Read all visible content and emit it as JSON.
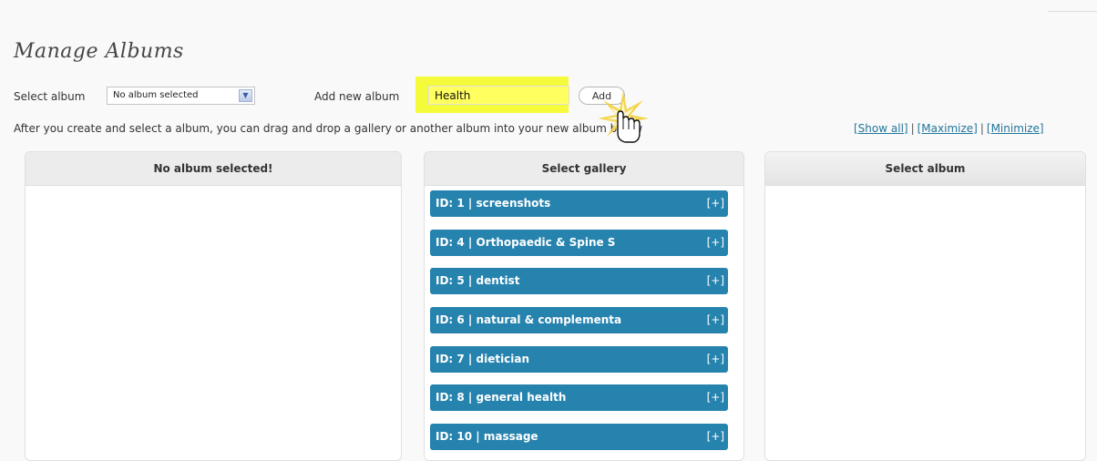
{
  "page": {
    "title": "Manage Albums"
  },
  "controls": {
    "select_album_label": "Select album",
    "select_album_value": "No album selected",
    "add_new_album_label": "Add new album",
    "new_album_value": "Health",
    "add_button_label": "Add",
    "highlight_color": "#f5fb3a"
  },
  "hint": {
    "text": "After you create and select a album, you can drag and drop a gallery or another album into your new album below",
    "links": {
      "show_all": "[Show all]",
      "maximize": "[Maximize]",
      "minimize": "[Minimize]",
      "separator": "|"
    }
  },
  "panels": {
    "left": {
      "title": "No album selected!"
    },
    "middle": {
      "title": "Select gallery",
      "items": [
        {
          "label": "ID: 1 | screenshots",
          "action": "[+]"
        },
        {
          "label": "ID: 4 | Orthopaedic & Spine S",
          "action": "[+]"
        },
        {
          "label": "ID: 5 | dentist",
          "action": "[+]"
        },
        {
          "label": "ID: 6 | natural & complementa",
          "action": "[+]"
        },
        {
          "label": "ID: 7 | dietician",
          "action": "[+]"
        },
        {
          "label": "ID: 8 | general health",
          "action": "[+]"
        },
        {
          "label": "ID: 10 | massage",
          "action": "[+]"
        }
      ]
    },
    "right": {
      "title": "Select album"
    }
  },
  "icons": {
    "cursor": "hand-pointer-icon",
    "select_arrow": "chevron-down-icon"
  },
  "colors": {
    "gallery_item_bg": "#2683ae",
    "link": "#21759b"
  }
}
